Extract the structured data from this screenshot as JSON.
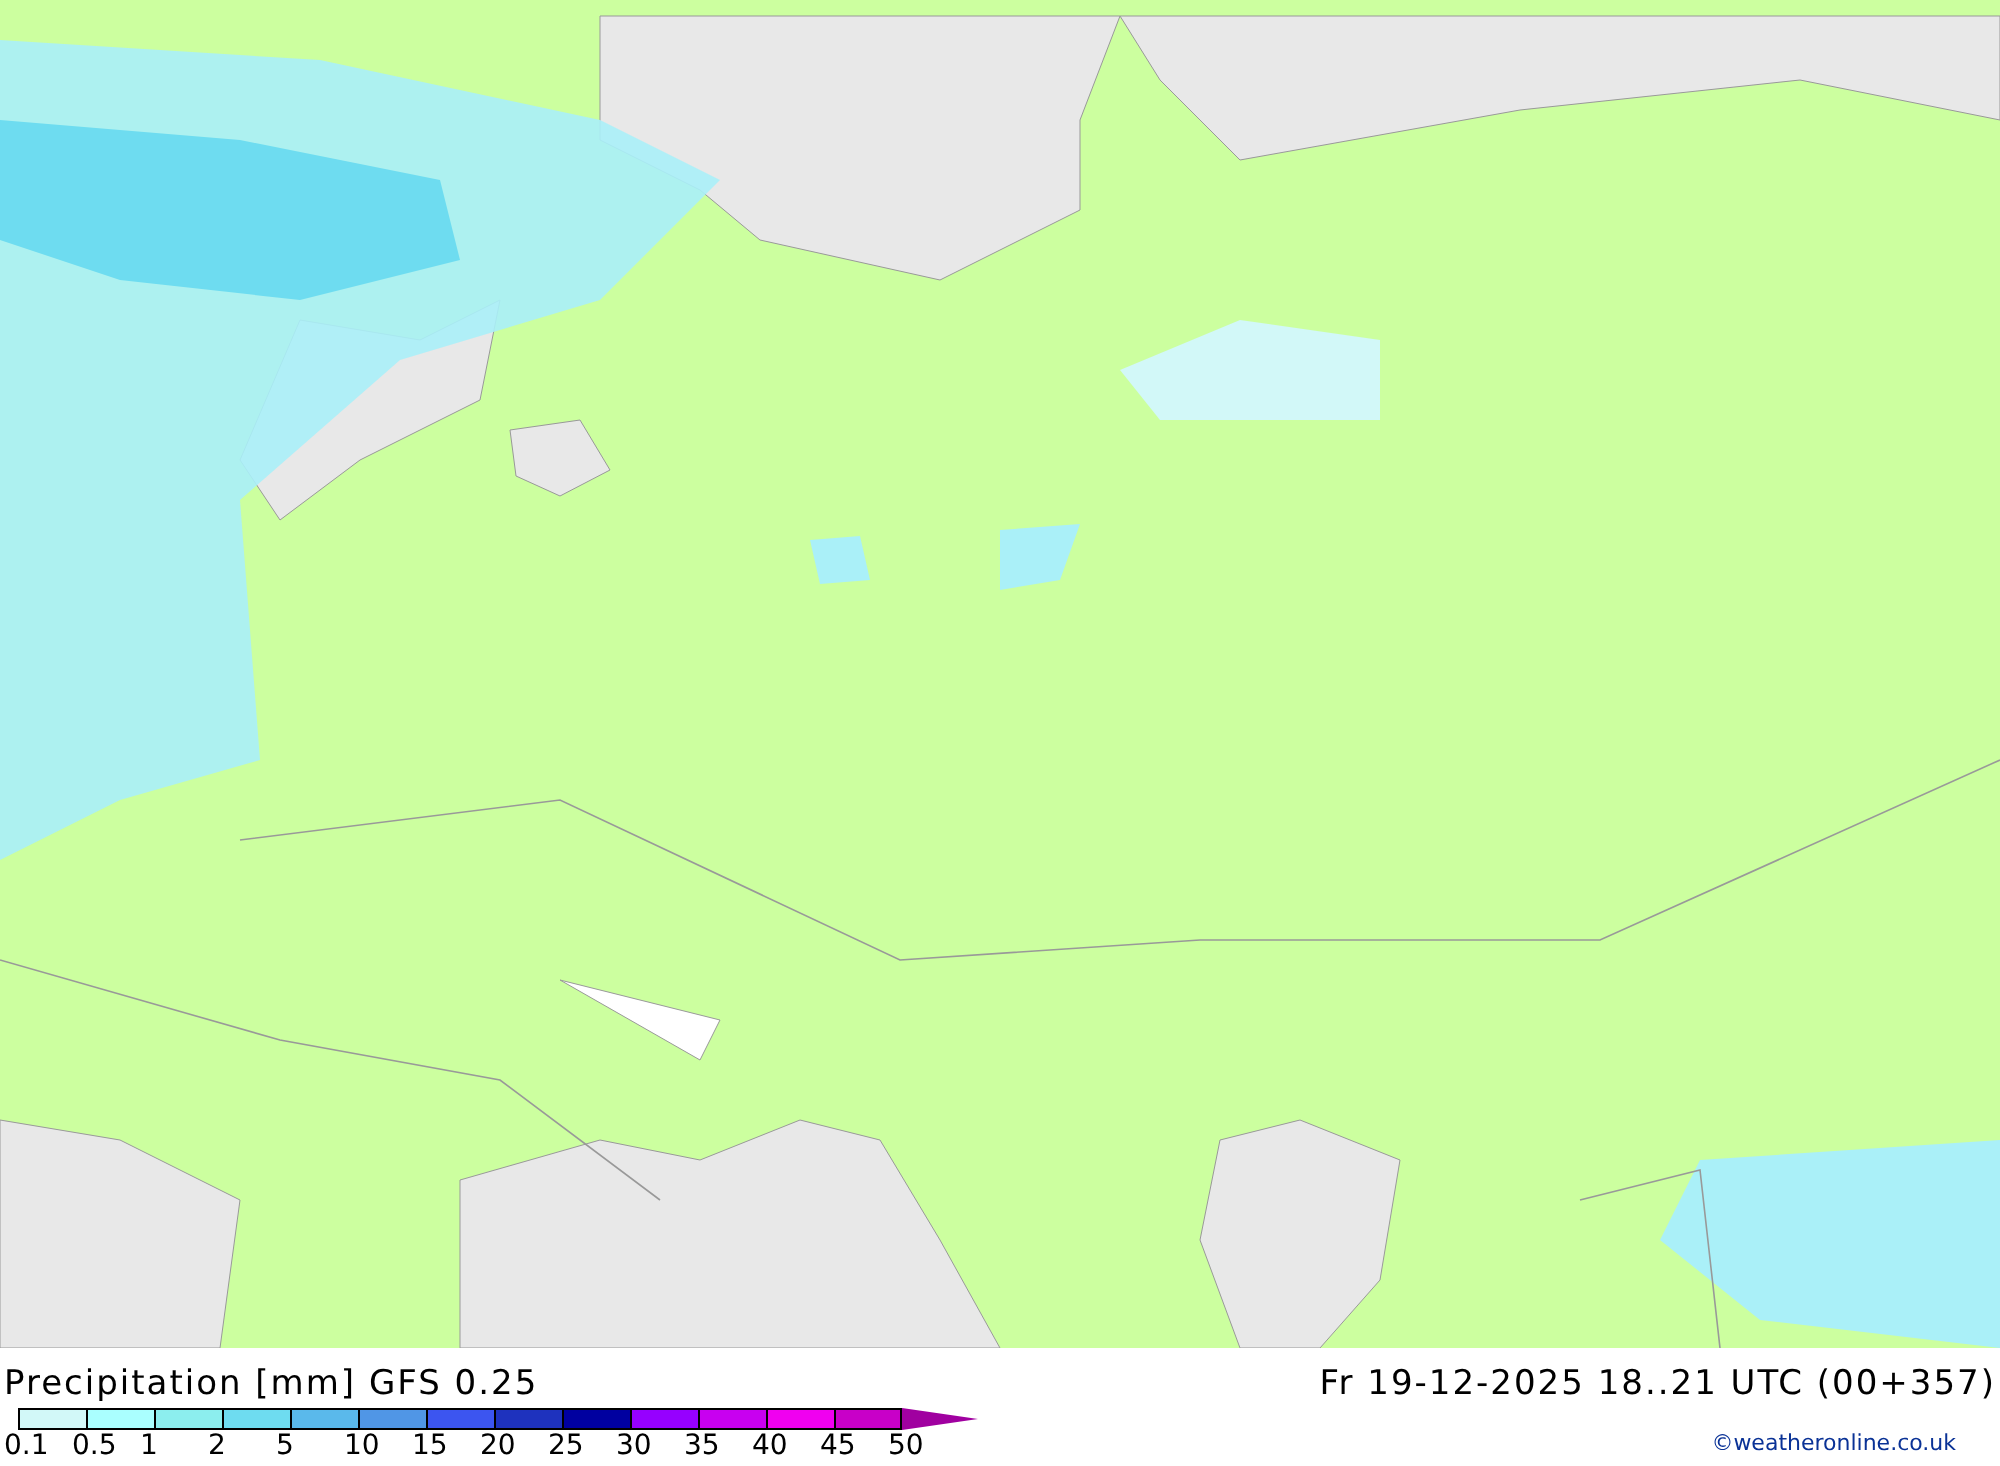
{
  "title": "Precipitation [mm] GFS 0.25",
  "valid_time": "Fr 19-12-2025 18..21 UTC (00+357)",
  "scale": [
    {
      "label": "0.1",
      "color": "#d2f8f8"
    },
    {
      "label": "0.5",
      "color": "#aaffff"
    },
    {
      "label": "1",
      "color": "#8ceeee"
    },
    {
      "label": "2",
      "color": "#6edcf0"
    },
    {
      "label": "5",
      "color": "#5ab9eb"
    },
    {
      "label": "10",
      "color": "#5096e6"
    },
    {
      "label": "15",
      "color": "#3c55f0"
    },
    {
      "label": "20",
      "color": "#1e32be"
    },
    {
      "label": "25",
      "color": "#0000a0"
    },
    {
      "label": "30",
      "color": "#9600ff"
    },
    {
      "label": "35",
      "color": "#c800f0"
    },
    {
      "label": "40",
      "color": "#f000f0"
    },
    {
      "label": "45",
      "color": "#c800c8"
    }
  ],
  "scale_max_label": "50",
  "credit": "©weatheronline.co.uk"
}
